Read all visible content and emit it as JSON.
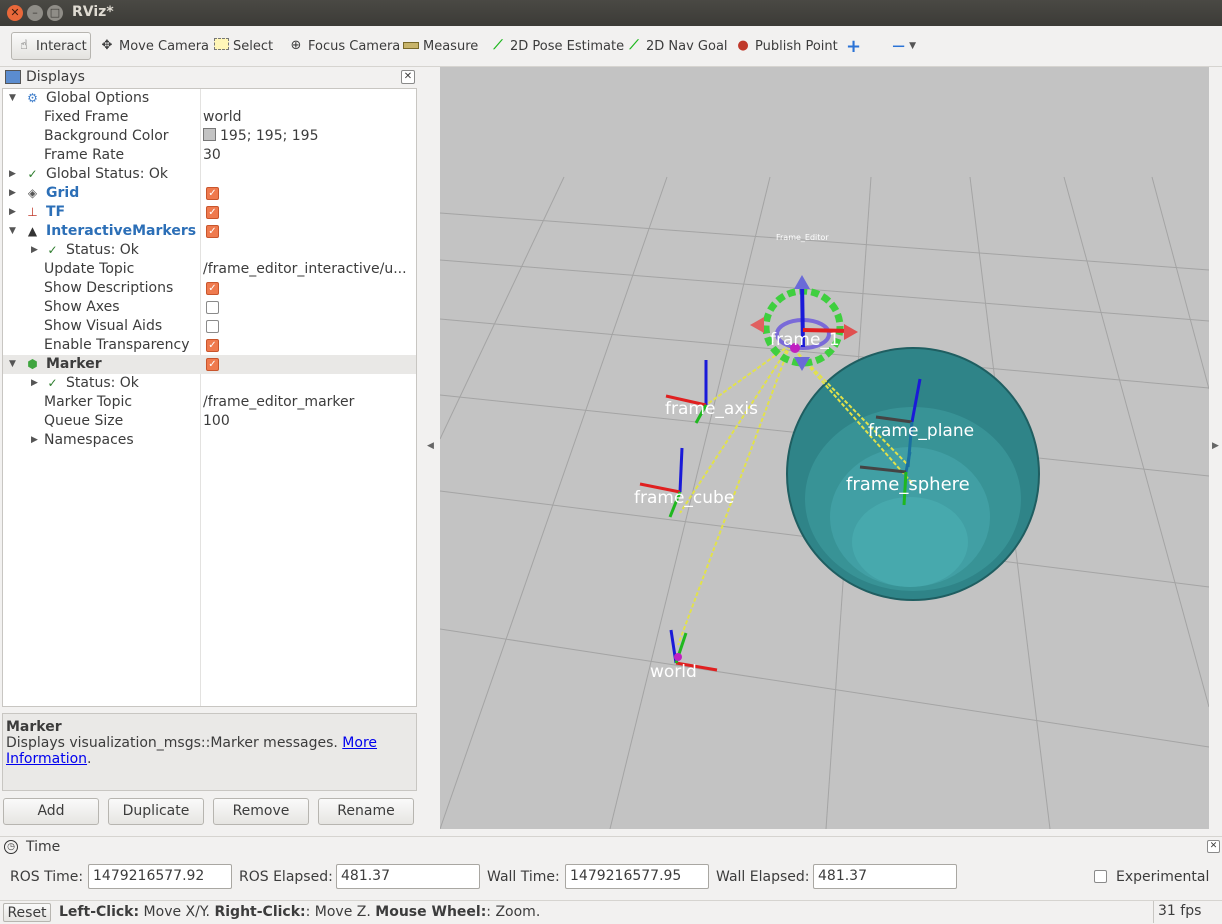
{
  "window": {
    "title": "RViz*"
  },
  "toolbar": {
    "tools": [
      {
        "label": "Interact",
        "icon": "hand-pointer-icon"
      },
      {
        "label": "Move Camera",
        "icon": "move-camera-icon"
      },
      {
        "label": "Select",
        "icon": "select-box-icon"
      },
      {
        "label": "Focus Camera",
        "icon": "crosshair-icon"
      },
      {
        "label": "Measure",
        "icon": "ruler-icon"
      },
      {
        "label": "2D Pose Estimate",
        "icon": "green-arrow-icon"
      },
      {
        "label": "2D Nav Goal",
        "icon": "green-arrow-icon"
      },
      {
        "label": "Publish Point",
        "icon": "map-pin-icon"
      }
    ]
  },
  "displays": {
    "title": "Displays",
    "rows": [
      {
        "label": "Global Options",
        "value": ""
      },
      {
        "label": "Fixed Frame",
        "value": "world"
      },
      {
        "label": "Background Color",
        "value": "195; 195; 195"
      },
      {
        "label": "Frame Rate",
        "value": "30"
      },
      {
        "label": "Global Status: Ok",
        "value": ""
      },
      {
        "label": "Grid",
        "value": ""
      },
      {
        "label": "TF",
        "value": ""
      },
      {
        "label": "InteractiveMarkers",
        "value": ""
      },
      {
        "label": "Status: Ok",
        "value": ""
      },
      {
        "label": "Update Topic",
        "value": "/frame_editor_interactive/u..."
      },
      {
        "label": "Show Descriptions",
        "value": ""
      },
      {
        "label": "Show Axes",
        "value": ""
      },
      {
        "label": "Show Visual Aids",
        "value": ""
      },
      {
        "label": "Enable Transparency",
        "value": ""
      },
      {
        "label": "Marker",
        "value": ""
      },
      {
        "label": "Status: Ok",
        "value": ""
      },
      {
        "label": "Marker Topic",
        "value": "/frame_editor_marker"
      },
      {
        "label": "Queue Size",
        "value": "100"
      },
      {
        "label": "Namespaces",
        "value": ""
      }
    ],
    "checks": {
      "grid": true,
      "tf": true,
      "interactive": true,
      "show_descriptions": true,
      "show_axes": false,
      "show_visual_aids": false,
      "enable_transparency": true,
      "marker": true
    }
  },
  "description": {
    "title": "Marker",
    "text": "Displays visualization_msgs::Marker messages.",
    "link1": "More",
    "link2": "Information",
    "tail": "."
  },
  "panel_buttons": [
    "Add",
    "Duplicate",
    "Remove",
    "Rename"
  ],
  "viewport": {
    "background": "#c3c3c3",
    "caption": "Frame_Editor",
    "frames": [
      "frame_1",
      "frame_axis",
      "frame_cube",
      "frame_plane",
      "frame_sphere",
      "world"
    ]
  },
  "time": {
    "title": "Time",
    "ros_time_label": "ROS Time:",
    "ros_time": "1479216577.92",
    "ros_elapsed_label": "ROS Elapsed:",
    "ros_elapsed": "481.37",
    "wall_time_label": "Wall Time:",
    "wall_time": "1479216577.95",
    "wall_elapsed_label": "Wall Elapsed:",
    "wall_elapsed": "481.37",
    "experimental_label": "Experimental"
  },
  "status": {
    "reset": "Reset",
    "hint_a": "Left-Click:",
    "hint_b": " Move X/Y. ",
    "hint_c": "Right-Click:",
    "hint_d": ": Move Z. ",
    "hint_e": "Mouse Wheel:",
    "hint_f": ": Zoom.",
    "fps": "31 fps"
  }
}
